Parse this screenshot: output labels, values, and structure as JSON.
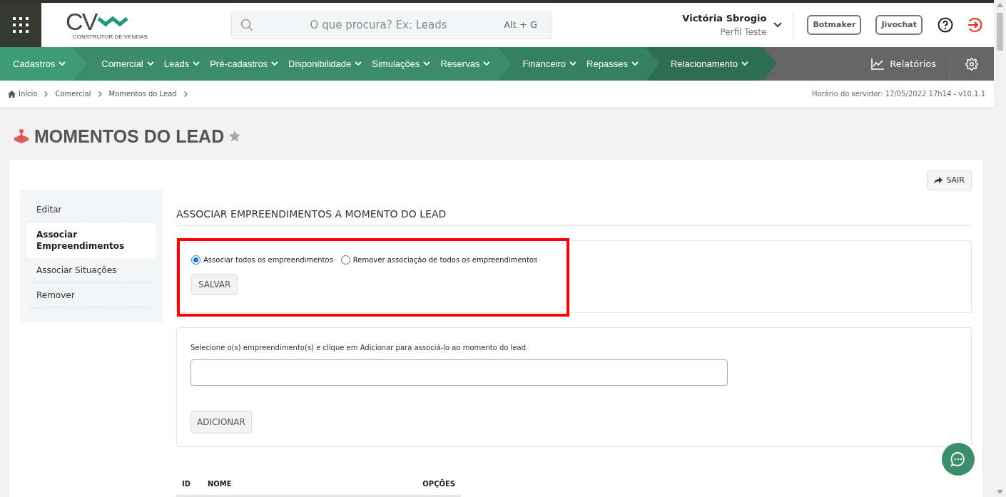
{
  "header": {
    "logo": {
      "mark": "CV",
      "tagline": "CONSTRUTOR DE VENDAS"
    },
    "search": {
      "placeholder": "O que procura? Ex: Leads",
      "shortcut": "Alt + G"
    },
    "user": {
      "name": "Victória Sbrogio",
      "profile": "Perfil Teste"
    },
    "buttons": [
      "Botmaker",
      "Jivochat"
    ]
  },
  "nav": {
    "groups": [
      {
        "items": [
          "Cadastros"
        ]
      },
      {
        "items": [
          "Comercial",
          "Leads",
          "Pré-cadastros",
          "Disponibilidade",
          "Simulações",
          "Reservas"
        ]
      },
      {
        "items": [
          "Financeiro",
          "Repasses"
        ]
      },
      {
        "items": [
          "Relacionamento"
        ]
      }
    ],
    "reports": "Relatórios"
  },
  "breadcrumb": [
    "Início",
    "Comercial",
    "Momentos do Lead"
  ],
  "server_time": "Horário do servidor: 17/05/2022 17h14 - v10.1.1",
  "page": {
    "title": "MOMENTOS DO LEAD",
    "favorite": false,
    "exit_button": "SAIR"
  },
  "sidebar": {
    "items": [
      {
        "label": "Editar",
        "selected": false
      },
      {
        "label": "Associar Empreendimentos",
        "selected": true
      },
      {
        "label": "Associar Situações",
        "selected": false
      },
      {
        "label": "Remover",
        "selected": false
      }
    ]
  },
  "section_title": "ASSOCIAR EMPREENDIMENTOS A MOMENTO DO LEAD",
  "bulk": {
    "highlighted": true,
    "options": [
      {
        "label": "Associar todos os empreendimentos",
        "selected": true
      },
      {
        "label": "Remover associação de todos os empreendimentos",
        "selected": false
      }
    ],
    "button": "SALVAR"
  },
  "add": {
    "instruction": "Selecione o(s) empreendimento(s) e clique em Adicionar para associá-lo ao momento do lead.",
    "button": "ADICIONAR"
  },
  "table": {
    "columns": [
      "ID",
      "NOME",
      "OPÇÕES"
    ]
  }
}
